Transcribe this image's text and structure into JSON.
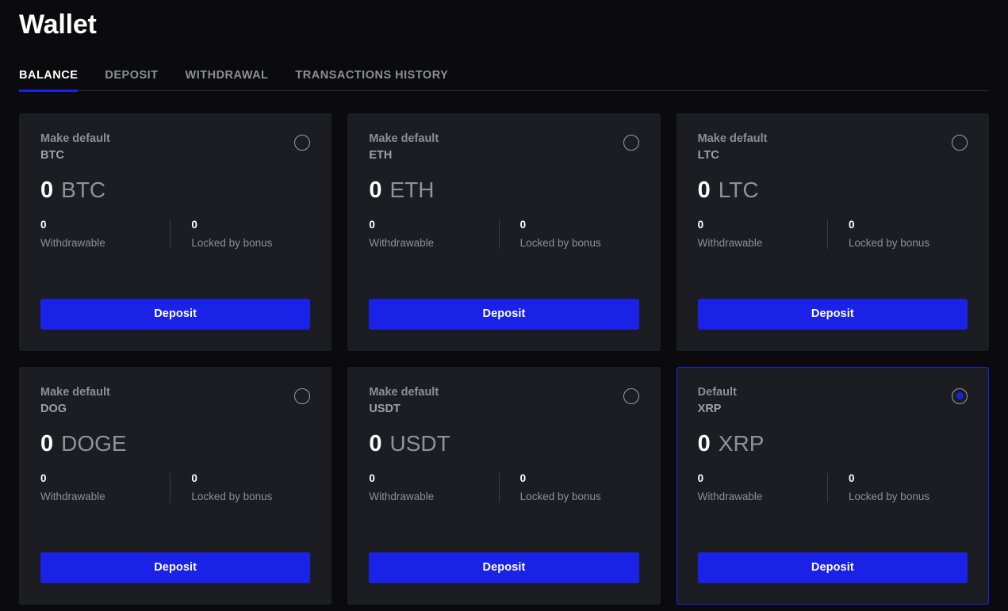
{
  "header": {
    "title": "Wallet",
    "tabs": [
      {
        "label": "BALANCE",
        "active": true
      },
      {
        "label": "DEPOSIT",
        "active": false
      },
      {
        "label": "WITHDRAWAL",
        "active": false
      },
      {
        "label": "TRANSACTIONS HISTORY",
        "active": false
      }
    ]
  },
  "labels": {
    "make_default": "Make default",
    "default": "Default",
    "withdrawable": "Withdrawable",
    "locked_by_bonus": "Locked by bonus",
    "deposit": "Deposit"
  },
  "colors": {
    "accent": "#1a22e8",
    "page_background": "#0b0b0d",
    "card_background": "#1b1d23",
    "muted_text": "#8b8f98"
  },
  "cards": [
    {
      "code": "BTC",
      "default_label": "Make default",
      "is_default": false,
      "balance": "0",
      "ticker": "BTC",
      "withdrawable": "0",
      "withdrawable_label": "Withdrawable",
      "locked": "0",
      "locked_label": "Locked by bonus",
      "deposit_label": "Deposit"
    },
    {
      "code": "ETH",
      "default_label": "Make default",
      "is_default": false,
      "balance": "0",
      "ticker": "ETH",
      "withdrawable": "0",
      "withdrawable_label": "Withdrawable",
      "locked": "0",
      "locked_label": "Locked by bonus",
      "deposit_label": "Deposit"
    },
    {
      "code": "LTC",
      "default_label": "Make default",
      "is_default": false,
      "balance": "0",
      "ticker": "LTC",
      "withdrawable": "0",
      "withdrawable_label": "Withdrawable",
      "locked": "0",
      "locked_label": "Locked by bonus",
      "deposit_label": "Deposit"
    },
    {
      "code": "DOG",
      "default_label": "Make default",
      "is_default": false,
      "balance": "0",
      "ticker": "DOGE",
      "withdrawable": "0",
      "withdrawable_label": "Withdrawable",
      "locked": "0",
      "locked_label": "Locked by bonus",
      "deposit_label": "Deposit"
    },
    {
      "code": "USDT",
      "default_label": "Make default",
      "is_default": false,
      "balance": "0",
      "ticker": "USDT",
      "withdrawable": "0",
      "withdrawable_label": "Withdrawable",
      "locked": "0",
      "locked_label": "Locked by bonus",
      "deposit_label": "Deposit"
    },
    {
      "code": "XRP",
      "default_label": "Default",
      "is_default": true,
      "balance": "0",
      "ticker": "XRP",
      "withdrawable": "0",
      "withdrawable_label": "Withdrawable",
      "locked": "0",
      "locked_label": "Locked by bonus",
      "deposit_label": "Deposit"
    }
  ]
}
